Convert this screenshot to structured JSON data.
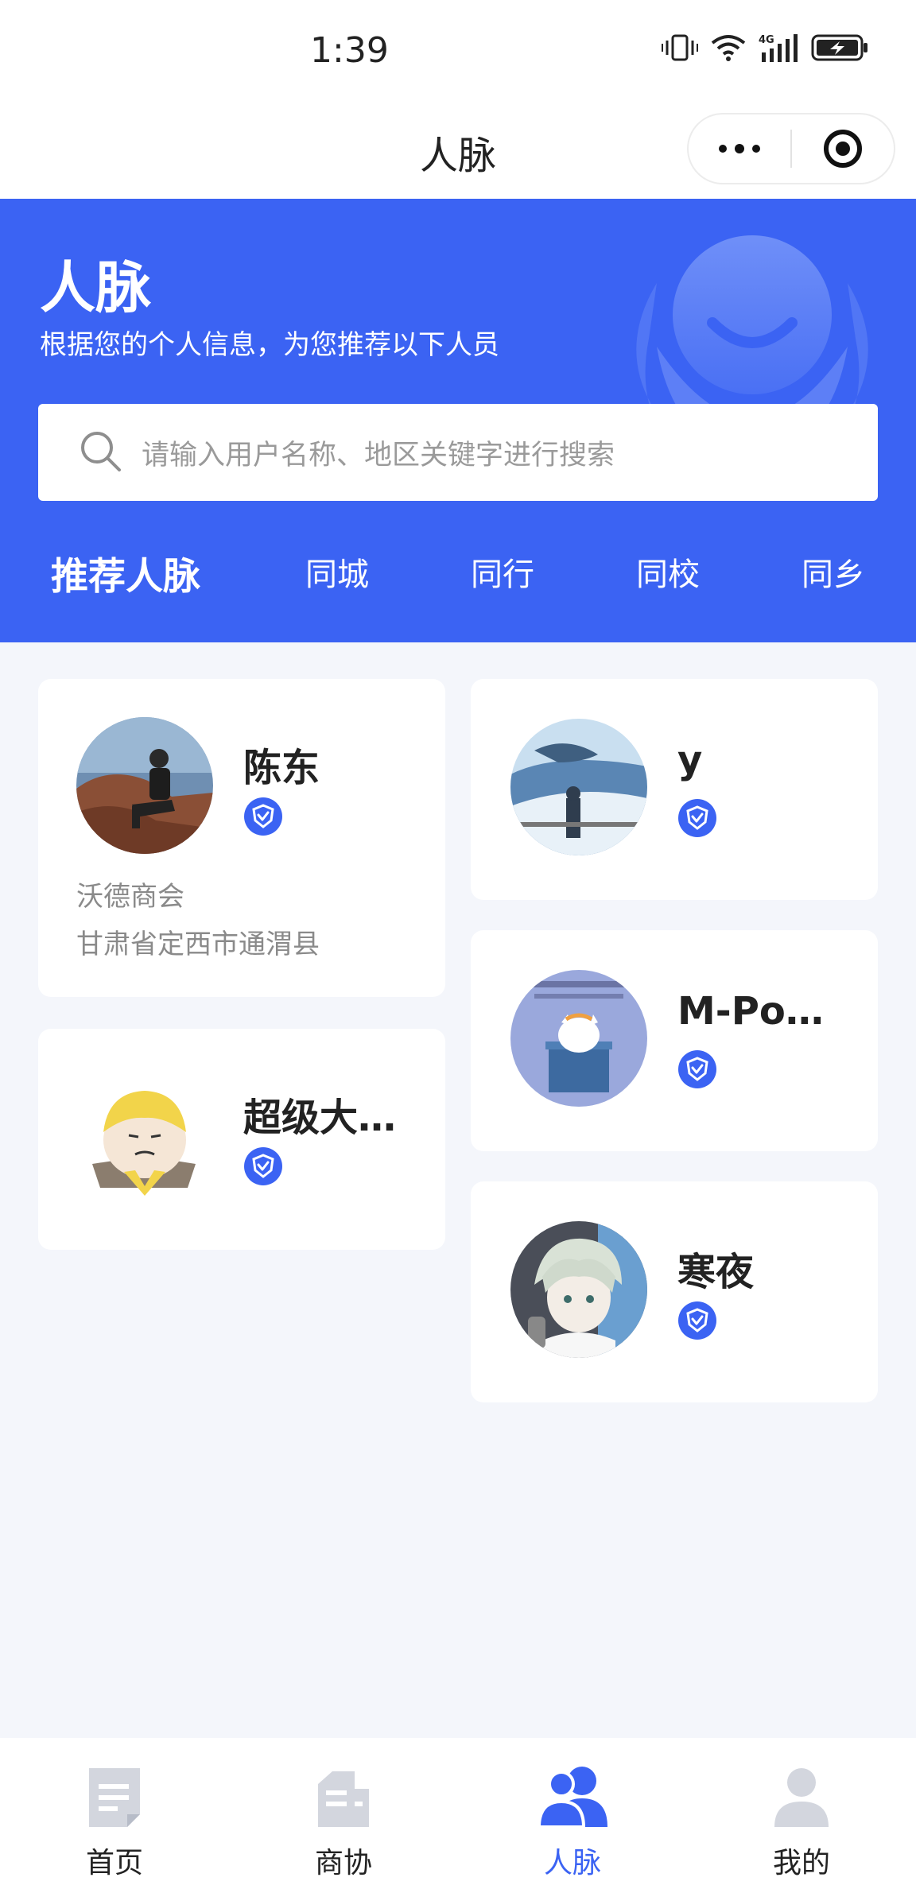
{
  "status_bar": {
    "time": "1:39",
    "icons": [
      "vibrate-icon",
      "wifi-icon",
      "signal-4g-icon",
      "battery-charging-icon"
    ],
    "network_label": "4G"
  },
  "nav": {
    "title": "人脉",
    "menu_icon": "more-dots-icon",
    "close_icon": "target-circle-icon"
  },
  "header": {
    "title": "人脉",
    "subtitle": "根据您的个人信息，为您推荐以下人员",
    "accent_color": "#3b63f3"
  },
  "search": {
    "placeholder": "请输入用户名称、地区关键字进行搜索",
    "icon": "search-icon"
  },
  "tabs": [
    {
      "label": "推荐人脉",
      "active": true
    },
    {
      "label": "同城",
      "active": false
    },
    {
      "label": "同行",
      "active": false
    },
    {
      "label": "同校",
      "active": false
    },
    {
      "label": "同乡",
      "active": false
    }
  ],
  "people": [
    {
      "name": "陈东",
      "verified": true,
      "org": "沃德商会",
      "location": "甘肃省定西市通渭县",
      "avatar": "avatar-photo-man-seaside"
    },
    {
      "name": "y",
      "verified": true,
      "avatar": "avatar-whale-scene"
    },
    {
      "name": "超级大…",
      "verified": true,
      "avatar": "avatar-cartoon-yellow-hat"
    },
    {
      "name": "M-Po…",
      "verified": true,
      "avatar": "avatar-cartoon-cat-box"
    },
    {
      "name": "寒夜",
      "verified": true,
      "avatar": "avatar-anime-boy"
    }
  ],
  "tabbar": [
    {
      "label": "首页",
      "icon": "home-doc-icon",
      "active": false
    },
    {
      "label": "商协",
      "icon": "building-icon",
      "active": false
    },
    {
      "label": "人脉",
      "icon": "contacts-icon",
      "active": true
    },
    {
      "label": "我的",
      "icon": "user-icon",
      "active": false
    }
  ]
}
